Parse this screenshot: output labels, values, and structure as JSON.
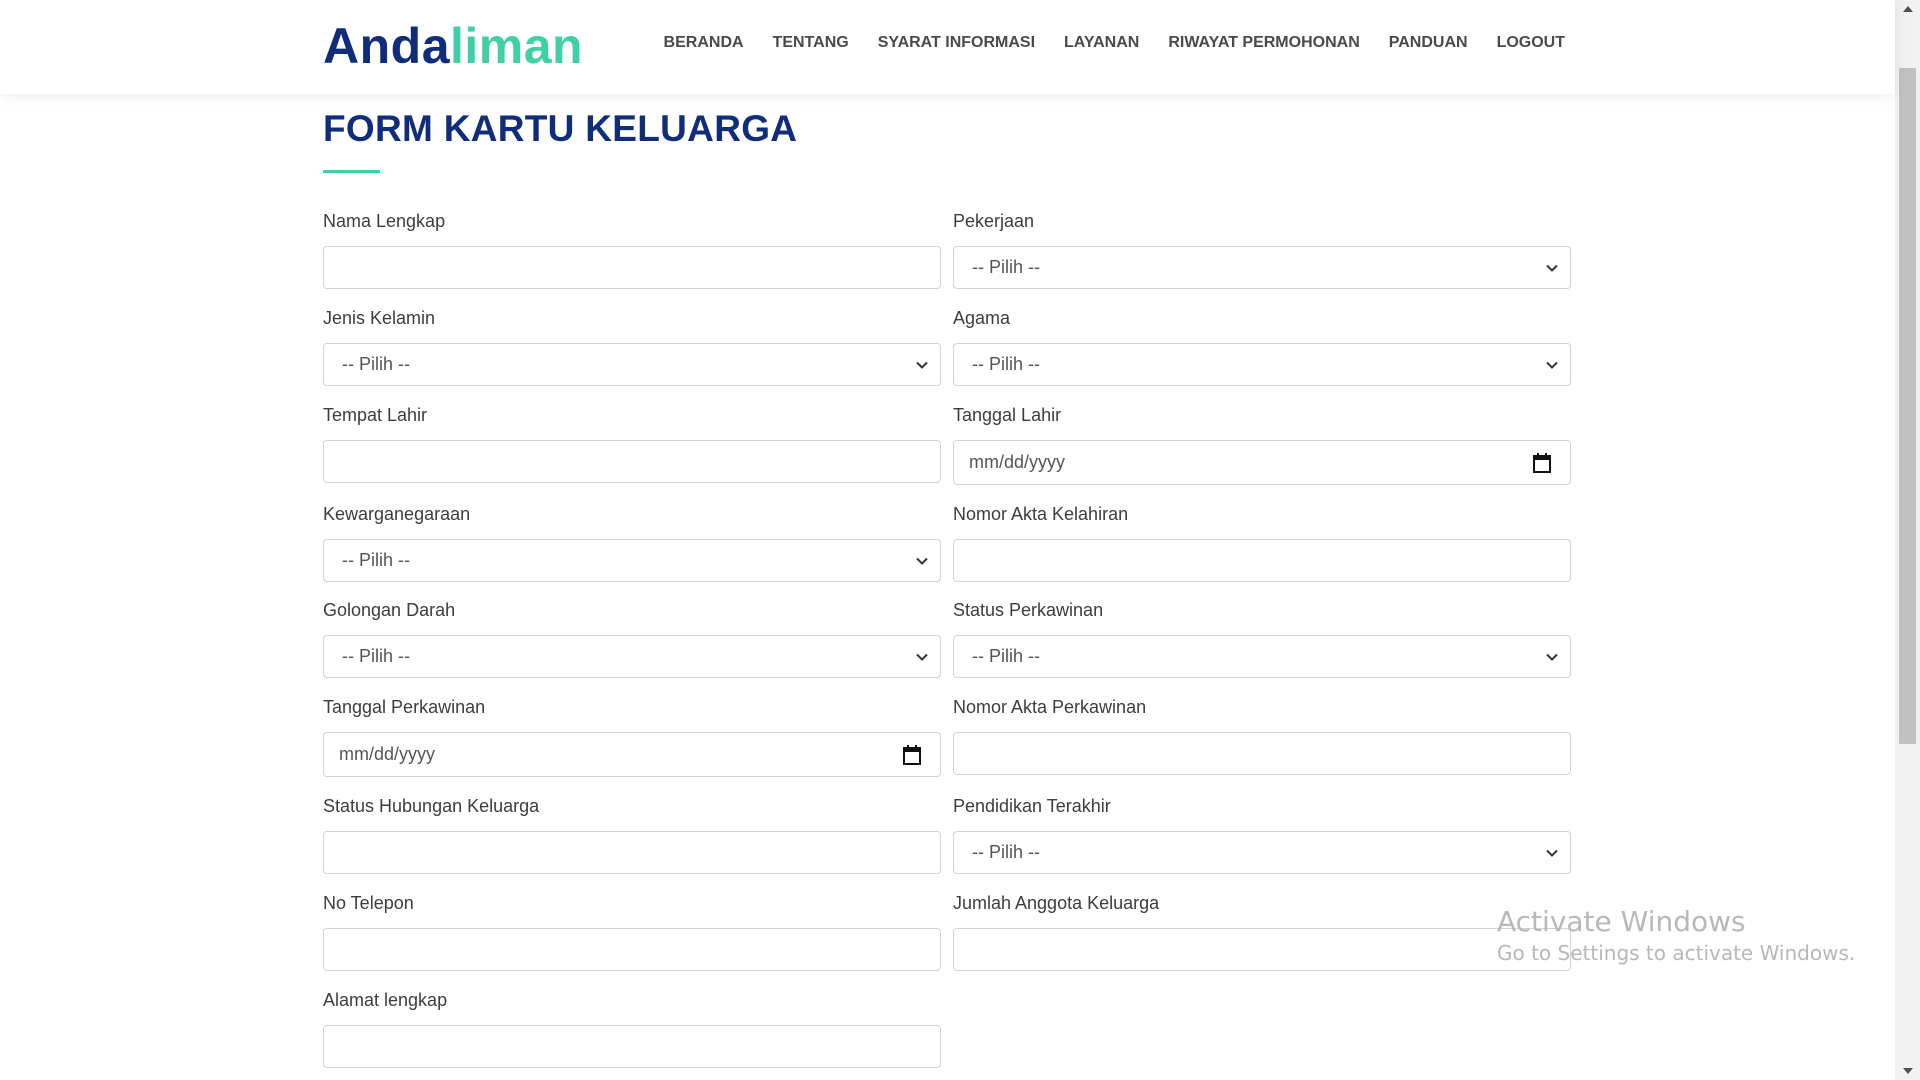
{
  "header": {
    "logo_part1": "Anda",
    "logo_part2": "liman",
    "nav": [
      "BERANDA",
      "TENTANG",
      "SYARAT INFORMASI",
      "LAYANAN",
      "RIWAYAT PERMOHONAN",
      "PANDUAN",
      "LOGOUT"
    ]
  },
  "page": {
    "title": "FORM KARTU KELUARGA"
  },
  "form": {
    "nama_lengkap": {
      "label": "Nama Lengkap",
      "value": ""
    },
    "pekerjaan": {
      "label": "Pekerjaan",
      "value": "-- Pilih --"
    },
    "jenis_kelamin": {
      "label": "Jenis Kelamin",
      "value": "-- Pilih --"
    },
    "agama": {
      "label": "Agama",
      "value": "-- Pilih --"
    },
    "tempat_lahir": {
      "label": "Tempat Lahir",
      "value": ""
    },
    "tanggal_lahir": {
      "label": "Tanggal Lahir",
      "placeholder": "mm/dd/yyyy"
    },
    "kewarganegaraan": {
      "label": "Kewarganegaraan",
      "value": "-- Pilih --"
    },
    "nomor_akta_kelahiran": {
      "label": "Nomor Akta Kelahiran",
      "value": ""
    },
    "golongan_darah": {
      "label": "Golongan Darah",
      "value": "-- Pilih --"
    },
    "status_perkawinan": {
      "label": "Status Perkawinan",
      "value": "-- Pilih --"
    },
    "tanggal_perkawinan": {
      "label": "Tanggal Perkawinan",
      "placeholder": "mm/dd/yyyy"
    },
    "nomor_akta_perkawinan": {
      "label": "Nomor Akta Perkawinan",
      "value": ""
    },
    "status_hubungan_keluarga": {
      "label": "Status Hubungan Keluarga",
      "value": ""
    },
    "pendidikan_terakhir": {
      "label": "Pendidikan Terakhir",
      "value": "-- Pilih --"
    },
    "no_telepon": {
      "label": "No Telepon",
      "value": ""
    },
    "jumlah_anggota_keluarga": {
      "label": "Jumlah Anggota Keluarga",
      "value": ""
    },
    "alamat_lengkap": {
      "label": "Alamat lengkap",
      "value": ""
    }
  },
  "watermark": {
    "line1": "Activate Windows",
    "line2": "Go to Settings to activate Windows."
  },
  "colors": {
    "brand_dark": "#0f2d7a",
    "brand_accent": "#3fd0a8"
  },
  "icons": {
    "dropdown": "chevron-down-icon",
    "date": "calendar-icon"
  }
}
